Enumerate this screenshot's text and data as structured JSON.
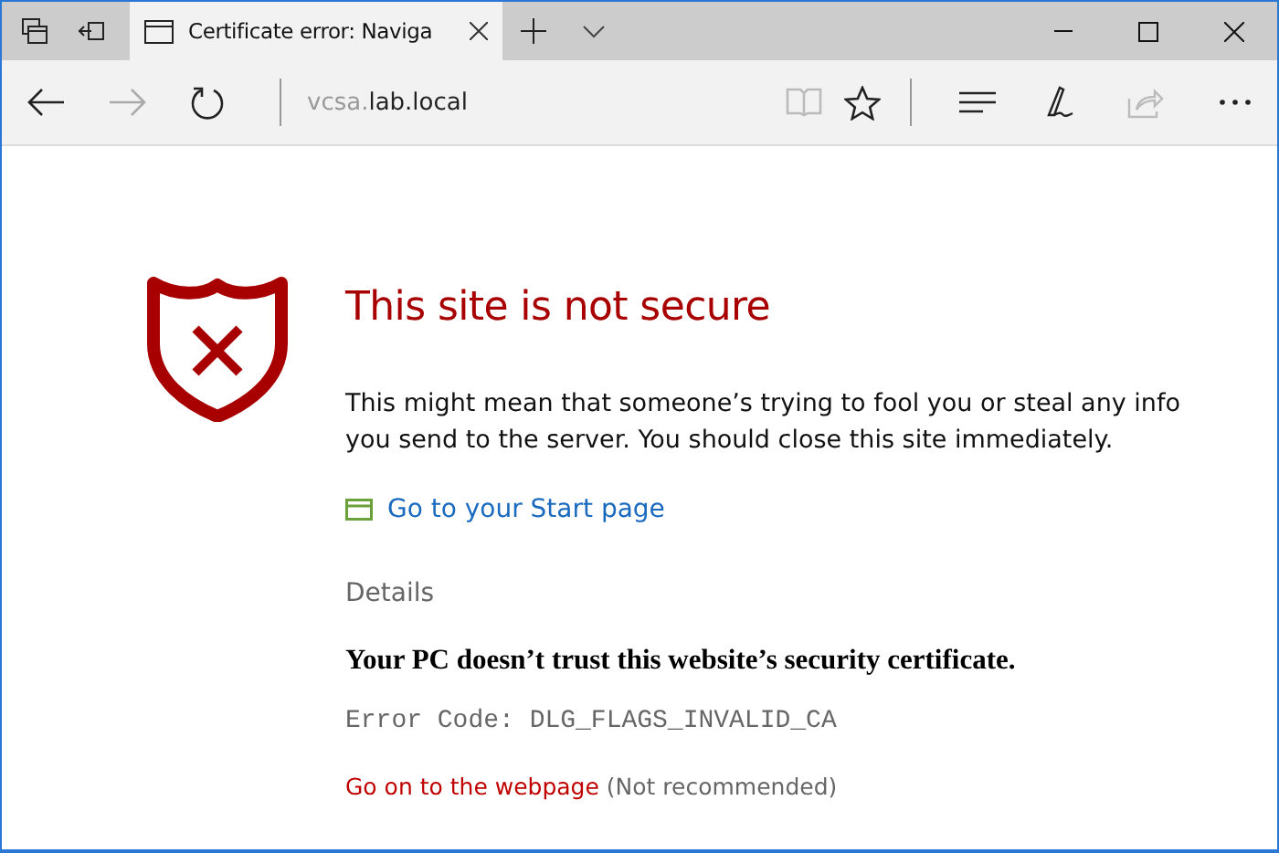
{
  "tabs": [
    {
      "title": "Certificate error: Naviga",
      "selected": true
    }
  ],
  "address": {
    "subdomain": "vcsa.",
    "domain": "lab.local"
  },
  "page": {
    "heading": "This site is not secure",
    "message": "This might mean that someone’s trying to fool you or steal any info you send to the server. You should close this site immediately.",
    "start_link": "Go to your Start page",
    "details_label": "Details",
    "detail_text": "Your PC doesn’t trust this website’s security certificate.",
    "error_code": "Error Code: DLG_FLAGS_INVALID_CA",
    "continue_link": "Go on to the webpage",
    "continue_note": "(Not recommended)"
  }
}
